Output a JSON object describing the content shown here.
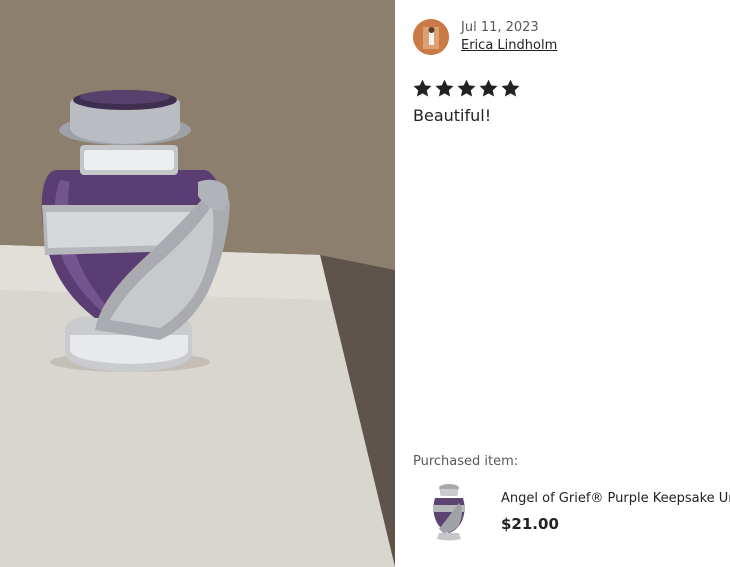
{
  "review": {
    "date": "Jul 11, 2023",
    "reviewer_name": "Erica Lindholm",
    "rating": 5,
    "text": "Beautiful!",
    "star_color": "#222222"
  },
  "purchase": {
    "label": "Purchased item:",
    "product_title": "Angel of Grief® Purple Keepsake Urn",
    "price": "$21.00"
  },
  "photo": {
    "icon": "review-photo-urn"
  }
}
